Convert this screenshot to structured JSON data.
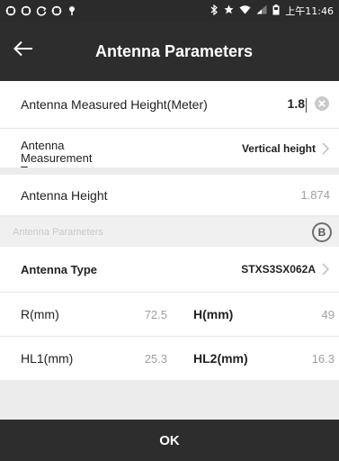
{
  "status_bar": {
    "time": "上午11:46",
    "icons_left": [
      "notification-icon",
      "notification-icon",
      "sync-icon",
      "notification-icon",
      "pin-icon"
    ],
    "icons_right": [
      "bluetooth-icon",
      "star-icon",
      "wifi-icon",
      "signal-icon",
      "battery-icon"
    ]
  },
  "app_bar": {
    "title": "Antenna Parameters",
    "back_icon": "back-arrow-icon"
  },
  "measured_height": {
    "label": "Antenna Measured Height(Meter)",
    "value": "1.8"
  },
  "measurement_type": {
    "label": "Antenna Measurement Type",
    "value": "Vertical height"
  },
  "antenna_height": {
    "label": "Antenna Height",
    "value": "1.874"
  },
  "section": {
    "label": "Antenna Parameters",
    "badge": "B"
  },
  "antenna_type": {
    "label": "Antenna Type",
    "value": "STXS3SX062A"
  },
  "params": {
    "r_label": "R(mm)",
    "r_value": "72.5",
    "h_label": "H(mm)",
    "h_value": "49",
    "hl1_label": "HL1(mm)",
    "hl1_value": "25.3",
    "hl2_label": "HL2(mm)",
    "hl2_value": "16.3"
  },
  "ok_label": "OK",
  "colors": {
    "bar_dark": "#2d2d2d",
    "background": "#ececec",
    "muted_text": "#a0a0a0"
  }
}
